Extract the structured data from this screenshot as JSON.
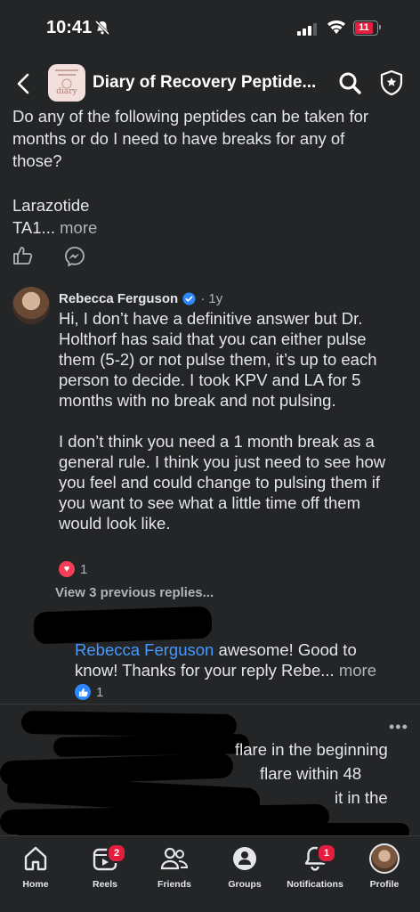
{
  "status_bar": {
    "time": "10:41",
    "battery": "11"
  },
  "header": {
    "group_title": "Diary of Recovery Peptide...",
    "avatar_text": "diary"
  },
  "post": {
    "line1": "Do any of the following peptides can be taken for months or do I need to have breaks for any of those?",
    "line2": "Larazotide",
    "line3": "TA1...",
    "more": "more"
  },
  "comment": {
    "author": "Rebecca Ferguson",
    "time": "· 1y",
    "para1": "Hi, I don’t have a definitive answer but Dr. Holthorf has said that you can either pulse them (5-2) or not pulse them, it’s up to each person to decide. I took KPV and LA for 5 months with no break and not pulsing.",
    "para2": "I don’t think you need a 1 month break as a general rule. I think you just need to see how you feel and could change to pulsing them if you want to see what a little time off them would look like.",
    "reaction_count": "1",
    "view_previous": "View 3 previous replies..."
  },
  "reply": {
    "mention": "Rebecca Ferguson",
    "text": " awesome! Good to know! Thanks for your reply Rebe...",
    "more": "more",
    "reaction_count": "1"
  },
  "next_post": {
    "line1": "flare in the beginning",
    "line2": "flare within 48",
    "line3": "it in the"
  },
  "nav": {
    "home": "Home",
    "reels": "Reels",
    "reels_badge": "2",
    "friends": "Friends",
    "groups": "Groups",
    "notifications": "Notifications",
    "notifications_badge": "1",
    "profile": "Profile"
  },
  "colors": {
    "background": "#242526",
    "text": "#e4e6eb",
    "link": "#4599ff",
    "badge": "#e41e3f",
    "like": "#2d88ff"
  }
}
